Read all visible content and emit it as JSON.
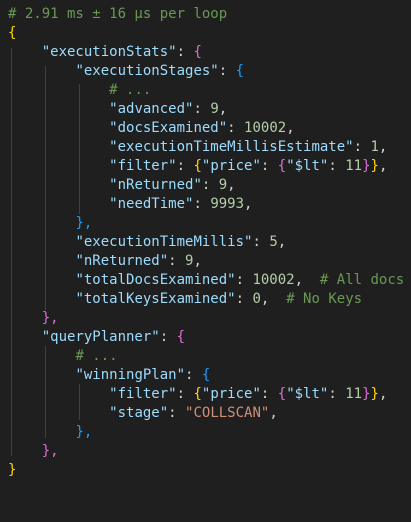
{
  "timing_comment": "# 2.91 ms ± 16 µs per loop",
  "tokens": {
    "open_brace": "{",
    "close_brace": "}",
    "close_brace_comma": "},",
    "colon": ": ",
    "comma": ",",
    "ellipsis_comment": "# ..."
  },
  "keys": {
    "executionStats": "\"executionStats\"",
    "executionStages": "\"executionStages\"",
    "advanced": "\"advanced\"",
    "docsExamined": "\"docsExamined\"",
    "executionTimeMillisEstimate": "\"executionTimeMillisEstimate\"",
    "filter": "\"filter\"",
    "price": "\"price\"",
    "lt": "\"$lt\"",
    "nReturned": "\"nReturned\"",
    "needTime": "\"needTime\"",
    "executionTimeMillis": "\"executionTimeMillis\"",
    "totalDocsExamined": "\"totalDocsExamined\"",
    "totalKeysExamined": "\"totalKeysExamined\"",
    "queryPlanner": "\"queryPlanner\"",
    "winningPlan": "\"winningPlan\"",
    "stage": "\"stage\""
  },
  "values": {
    "advanced": "9",
    "docsExamined": "10002",
    "executionTimeMillisEstimate": "1",
    "filter_lt": "11",
    "nReturned_stage": "9",
    "needTime": "9993",
    "executionTimeMillis": "5",
    "nReturned": "9",
    "totalDocsExamined": "10002",
    "totalKeysExamined": "0",
    "stage": "\"COLLSCAN\""
  },
  "inline_comments": {
    "totalDocsExamined": "# All docs",
    "totalKeysExamined": "# No Keys"
  },
  "colors": {
    "background": "#1f1f1f",
    "comment": "#6a9955",
    "key": "#9cdcfe",
    "string": "#ce9178",
    "number": "#b5cea8",
    "bracket_level1": "#ffd700",
    "bracket_level2": "#da70d6",
    "bracket_level3": "#179fff"
  }
}
